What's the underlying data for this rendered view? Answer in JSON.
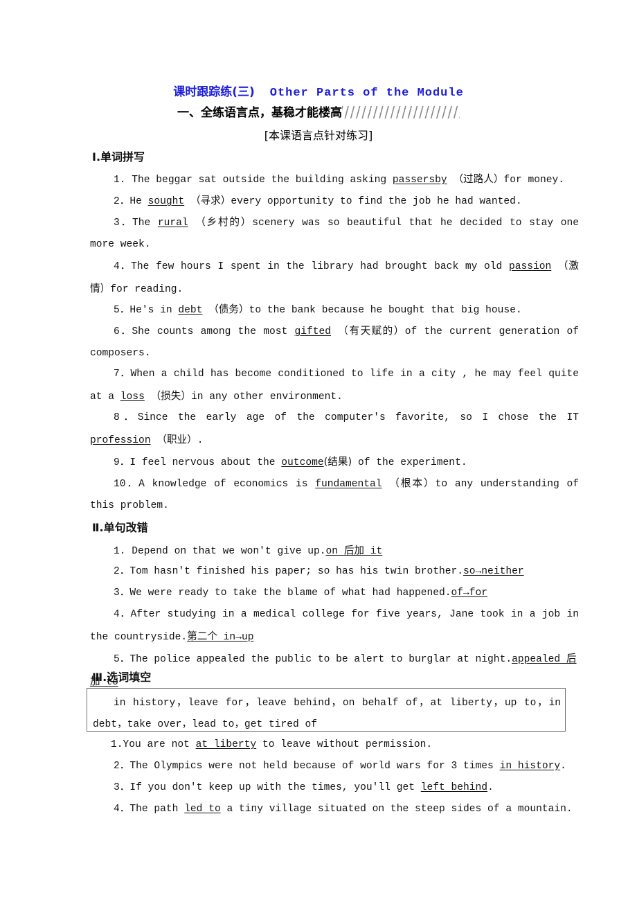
{
  "header": {
    "title_cn": "课时跟踪练(三)",
    "title_en": "Other Parts of the Module",
    "subheading_cn": "一、全练语言点，基稳才能楼高",
    "bracket_label": "[本课语言点针对练习]",
    "title_color": "#1d1ddd",
    "hatch_color": "#8a8a8a"
  },
  "sections": [
    {
      "heading": "Ⅰ.单词拼写",
      "items": [
        "1. The beggar sat outside the building asking passersby （过路人）for money.",
        "2．He sought （寻求）every opportunity to find the job he had wanted.",
        "3．The rural （乡村的）scenery was so beautiful that he decided to stay one more week.",
        "4．The few hours I spent in the library had brought back my old passion （激情）for reading.",
        "5．He's in debt （债务）to the bank because he bought that big house.",
        "6．She counts among the most gifted （有天赋的）of the current generation of composers.",
        "7．When a child has become conditioned to life in a city , he may feel quite at a loss （损失）in any other environment.",
        "8．Since the early age of the computer's favorite, so I chose the IT profession （职业）.",
        "9．I feel nervous about the outcome(结果) of the experiment.",
        "10．A knowledge of economics is fundamental （根本）to any understanding of this problem."
      ]
    },
    {
      "heading": "Ⅱ.单句改错",
      "items": [
        "1. Depend on that we won't give up.on 后加 it",
        "2．Tom hasn't finished his paper; so has his twin brother.so→neither",
        "3．We were ready to take the blame of what had happened.of→for",
        "4．After studying in a medical college for five years, Jane took in a job in the countryside.第二个 in→up",
        "5．The police appealed the public to be alert to burglar at night.appealed 后加 to"
      ]
    },
    {
      "heading": "Ⅲ.选词填空",
      "word_bank": "in history，leave for，leave behind，on behalf of，at liberty，up to，in debt，take over，lead to，get tired of",
      "items": [
        "1.You are not at liberty to leave without permission.",
        "2．The Olympics were not held because of world wars for 3 times in history.",
        "3．If you don't keep up with the times, you'll get left behind.",
        "4．The path led to a tiny village situated on the steep sides of a mountain."
      ]
    }
  ]
}
